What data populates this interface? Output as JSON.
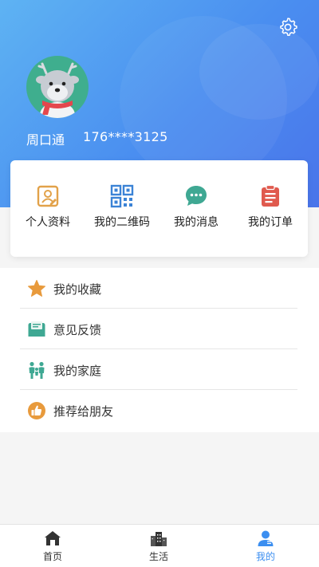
{
  "profile": {
    "name": "周口通",
    "phone": "176****3125"
  },
  "quick_actions": [
    {
      "label": "个人资料",
      "icon": "profile-edit-icon",
      "color": "#e2a24a"
    },
    {
      "label": "我的二维码",
      "icon": "qr-code-icon",
      "color": "#3b83d6"
    },
    {
      "label": "我的消息",
      "icon": "message-icon",
      "color": "#3fa893"
    },
    {
      "label": "我的订单",
      "icon": "order-icon",
      "color": "#e05a4e"
    }
  ],
  "menu": [
    {
      "label": "我的收藏",
      "icon": "star-icon",
      "color": "#e89a3c"
    },
    {
      "label": "意见反馈",
      "icon": "feedback-icon",
      "color": "#3fa893"
    },
    {
      "label": "我的家庭",
      "icon": "family-icon",
      "color": "#3fa893"
    },
    {
      "label": "推荐给朋友",
      "icon": "thumbs-up-icon",
      "color": "#e89a3c"
    }
  ],
  "tabs": [
    {
      "label": "首页",
      "icon": "home-icon"
    },
    {
      "label": "生活",
      "icon": "city-icon"
    },
    {
      "label": "我的",
      "icon": "user-icon",
      "active": true
    }
  ],
  "colors": {
    "header_start": "#5eb3f3",
    "header_end": "#4a74ea",
    "active_tab": "#3b8ef0"
  }
}
